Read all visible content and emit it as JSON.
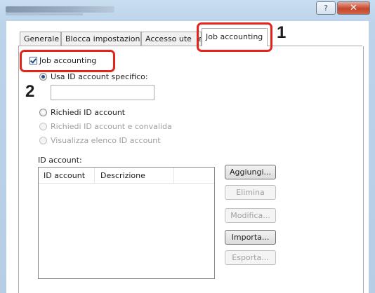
{
  "window": {
    "help_glyph": "?",
    "close_glyph": "✕"
  },
  "tabs": [
    {
      "label": "Generale",
      "active": false
    },
    {
      "label": "Blocca impostazioni",
      "active": false
    },
    {
      "label": "Accesso ute",
      "active": false
    },
    {
      "label": "Job accounting",
      "active": true
    }
  ],
  "callouts": {
    "step1": "1",
    "step2": "2"
  },
  "job_accounting": {
    "checkbox_label": "Job accounting",
    "checked": true
  },
  "options": {
    "use_specific_id": "Usa ID account specifico:",
    "specific_id_value": "",
    "request_id": "Richiedi ID account",
    "request_and_validate": "Richiedi ID account e convalida",
    "show_list": "Visualizza elenco ID account"
  },
  "id_list": {
    "label": "ID account:",
    "columns": [
      "ID account",
      "Descrizione"
    ],
    "rows": []
  },
  "buttons": {
    "add": "Aggiungi...",
    "delete": "Elimina",
    "edit": "Modifica...",
    "import": "Importa...",
    "export": "Esporta..."
  },
  "colors": {
    "highlight": "#e4231b",
    "selection_blue": "#2b4a8a"
  }
}
